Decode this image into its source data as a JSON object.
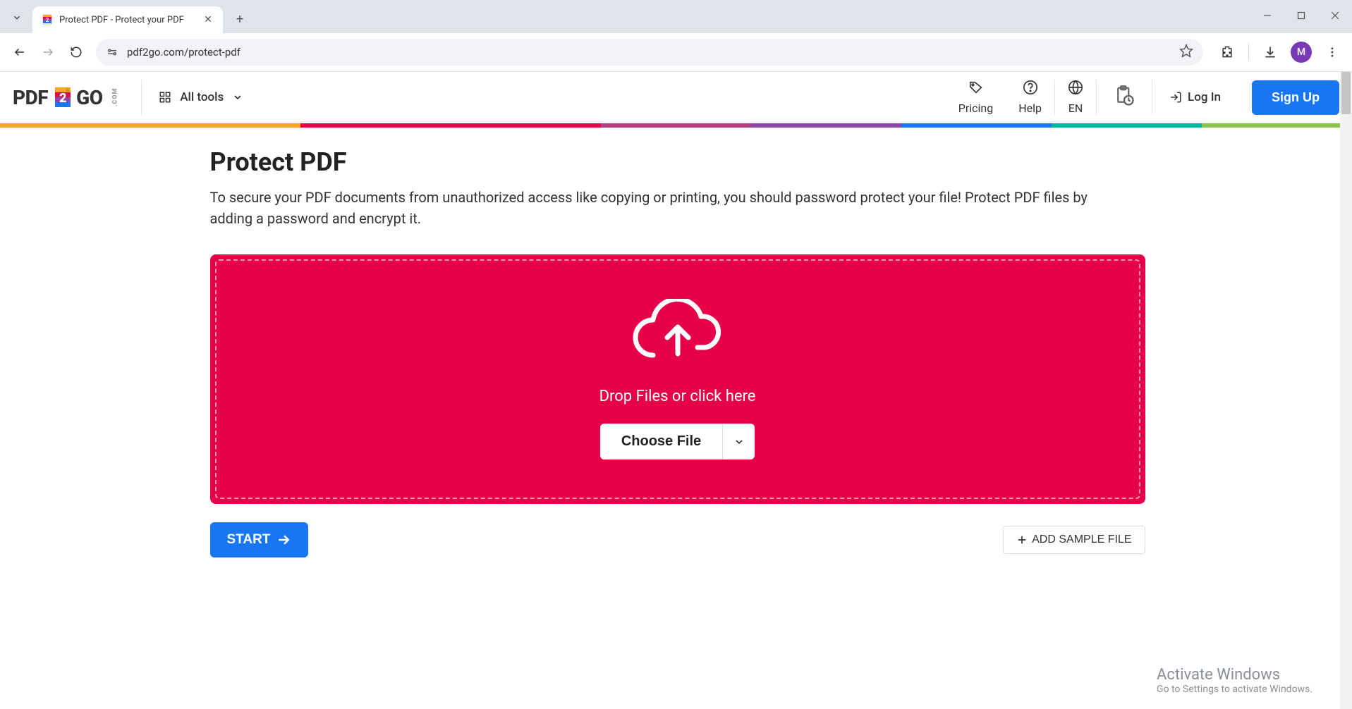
{
  "browser": {
    "tab_title": "Protect PDF - Protect your PDF",
    "url": "pdf2go.com/protect-pdf",
    "avatar_initial": "M"
  },
  "header": {
    "logo_pdf": "PDF",
    "logo_go": "GO",
    "logo_com": ".COM",
    "all_tools": "All tools",
    "pricing": "Pricing",
    "help": "Help",
    "lang": "EN",
    "login": "Log In",
    "signup": "Sign Up"
  },
  "rainbow_colors": [
    "#f5a623",
    "#f5a623",
    "#e50047",
    "#e50047",
    "#b83b7c",
    "#8e44ad",
    "#1976f2",
    "#00b5a0",
    "#8bc34a"
  ],
  "main": {
    "title": "Protect PDF",
    "description": "To secure your PDF documents from unauthorized access like copying or printing, you should password protect your file! Protect PDF files by adding a password and encrypt it.",
    "drop_text": "Drop Files or click here",
    "choose_file": "Choose File",
    "start": "START",
    "add_sample": "ADD SAMPLE FILE"
  },
  "watermark": {
    "title": "Activate Windows",
    "sub": "Go to Settings to activate Windows."
  }
}
